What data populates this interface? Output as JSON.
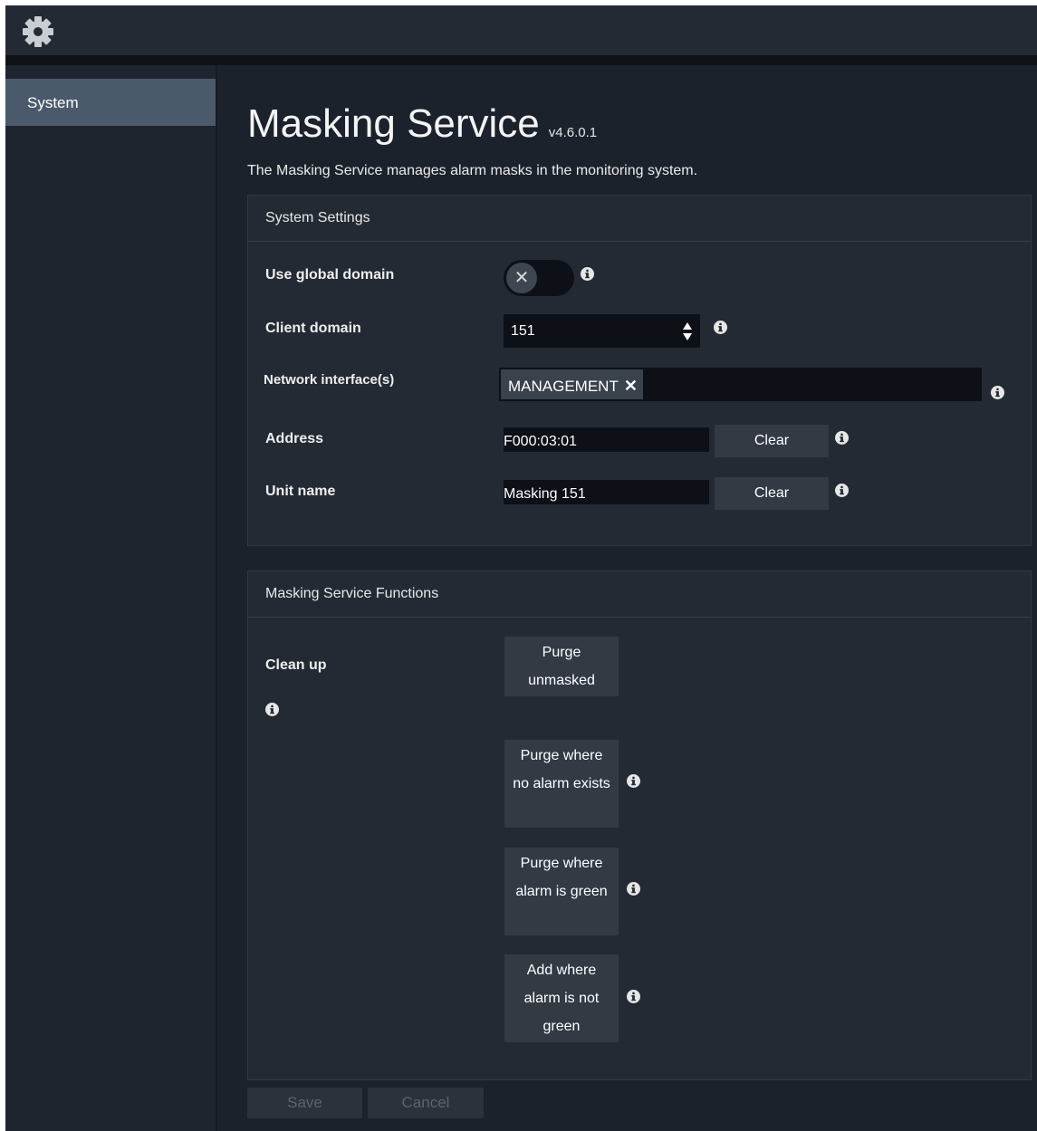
{
  "topbar": {
    "icon": "gear-icon"
  },
  "sidebar": {
    "items": [
      {
        "label": "System",
        "selected": true
      }
    ]
  },
  "header": {
    "title": "Masking Service",
    "version": "v4.6.0.1",
    "description": "The Masking Service manages alarm masks in the monitoring system."
  },
  "system_settings": {
    "heading": "System Settings",
    "use_global_domain": {
      "label": "Use global domain",
      "checked": false
    },
    "client_domain": {
      "label": "Client domain",
      "value": "151"
    },
    "network_interfaces": {
      "label": "Network interface(s)",
      "tags": [
        "MANAGEMENT"
      ],
      "remove_glyph": "✕"
    },
    "address": {
      "label": "Address",
      "value": "F000:03:01",
      "clear_label": "Clear"
    },
    "unit_name": {
      "label": "Unit name",
      "value": "Masking 151",
      "clear_label": "Clear"
    }
  },
  "functions": {
    "heading": "Masking Service Functions",
    "clean_up_label": "Clean up",
    "buttons": [
      {
        "label": "Purge unmasked"
      },
      {
        "label": "Purge where no alarm exists"
      },
      {
        "label": "Purge where alarm is green"
      },
      {
        "label": "Add where alarm is not green"
      }
    ]
  },
  "footer": {
    "save_label": "Save",
    "cancel_label": "Cancel"
  },
  "colors": {
    "background": "#1c222b",
    "panel": "#242a33",
    "sidebar_selected": "#4a5a6b",
    "input": "#0d1117",
    "button": "#333a44"
  }
}
